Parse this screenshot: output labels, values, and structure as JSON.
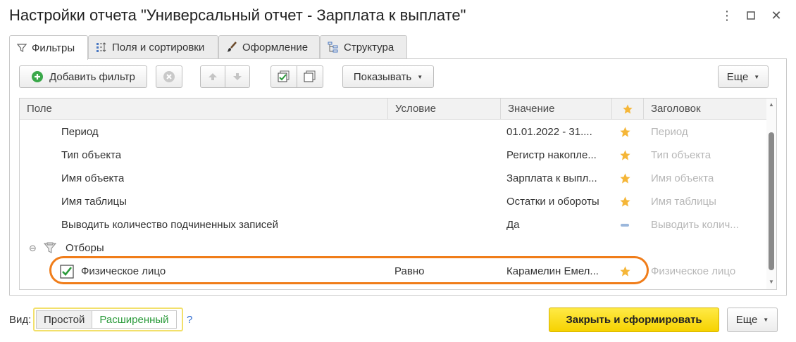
{
  "window": {
    "title": "Настройки отчета \"Универсальный отчет - Зарплата к выплате\"",
    "controls": [
      "more-vertical-icon",
      "maximize-icon",
      "close-icon"
    ]
  },
  "tabs": [
    {
      "label": "Фильтры",
      "icon": "filter-icon",
      "active": true
    },
    {
      "label": "Поля и сортировки",
      "icon": "fields-sort-icon",
      "active": false
    },
    {
      "label": "Оформление",
      "icon": "brush-icon",
      "active": false
    },
    {
      "label": "Структура",
      "icon": "structure-icon",
      "active": false
    }
  ],
  "toolbar": {
    "add_filter": "Добавить фильтр",
    "show": "Показывать",
    "more": "Еще"
  },
  "grid": {
    "columns": {
      "field": "Поле",
      "condition": "Условие",
      "value": "Значение",
      "star": "star-icon",
      "caption": "Заголовок"
    },
    "rows": [
      {
        "field": "Период",
        "condition": "",
        "value": "01.01.2022 - 31....",
        "mark": "star",
        "caption": "Период"
      },
      {
        "field": "Тип объекта",
        "condition": "",
        "value": "Регистр накопле...",
        "mark": "star",
        "caption": "Тип объекта"
      },
      {
        "field": "Имя объекта",
        "condition": "",
        "value": "Зарплата к выпл...",
        "mark": "star",
        "caption": "Имя объекта"
      },
      {
        "field": "Имя таблицы",
        "condition": "",
        "value": "Остатки и обороты",
        "mark": "star",
        "caption": "Имя таблицы"
      },
      {
        "field": "Выводить количество подчиненных записей",
        "condition": "",
        "value": "Да",
        "mark": "dash",
        "caption": "Выводить колич..."
      }
    ],
    "group": {
      "label": "Отборы",
      "collapse": "⊖"
    },
    "filter_row": {
      "field": "Физическое лицо",
      "checked": true,
      "condition": "Равно",
      "value": "Карамелин Емел...",
      "mark": "star",
      "caption": "Физическое лицо"
    }
  },
  "footer": {
    "view_label": "Вид:",
    "view_simple": "Простой",
    "view_extended": "Расширенный",
    "help": "?",
    "primary": "Закрыть и сформировать",
    "more": "Еще"
  },
  "colors": {
    "accent_orange": "#f07d1a",
    "star": "#f5b638",
    "primary_yellow": "#f6d200",
    "green": "#2a9a3a"
  }
}
